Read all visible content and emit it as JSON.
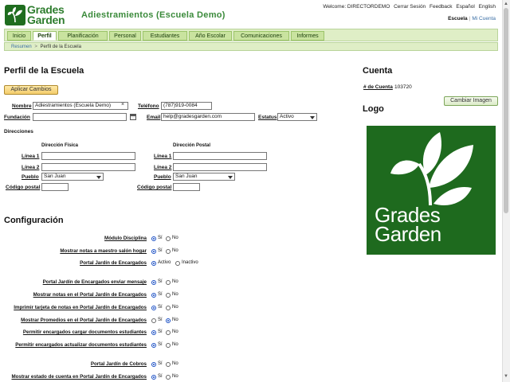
{
  "header": {
    "logo_text_1": "Grades",
    "logo_text_2": "Garden",
    "school_name": "Adiestramientos (Escuela Demo)",
    "welcome": "Welcome: DIRECTORDEMO",
    "links": [
      "Cerrar Sesión",
      "Feedback",
      "Español",
      "English"
    ],
    "school_link": "Escuela",
    "account_link": "Mi Cuenta"
  },
  "tabs": [
    {
      "label": "Inicio",
      "active": false
    },
    {
      "label": "Perfil",
      "active": true
    },
    {
      "label": "Planificación",
      "active": false
    },
    {
      "label": "Personal",
      "active": false
    },
    {
      "label": "Estudiantes",
      "active": false
    },
    {
      "label": "Año Escolar",
      "active": false
    },
    {
      "label": "Comunicaciones",
      "active": false
    },
    {
      "label": "Informes",
      "active": false
    }
  ],
  "breadcrumb": {
    "parent": "Resumen",
    "separator": ">",
    "current": "Perfil de la Escuela"
  },
  "profile": {
    "title": "Perfil de la Escuela",
    "apply_button": "Aplicar Cambios",
    "nombre_label": "Nombre",
    "nombre_value": "Adiestramientos (Escuela Demo)",
    "telefono_label": "Teléfono",
    "telefono_value": "(787)919-0084",
    "fundacion_label": "Fundación",
    "fundacion_value": "",
    "email_label": "Email",
    "email_value": "help@gradesgarden.com",
    "estatus_label": "Estatus",
    "estatus_value": "Activo"
  },
  "addresses": {
    "title": "Direcciones",
    "fisica_title": "Dirección Física",
    "postal_title": "Dirección Postal",
    "linea1": "Línea 1",
    "linea2": "Línea 2",
    "pueblo": "Pueblo",
    "codigo": "Código postal",
    "fisica_pueblo": "San Juan",
    "postal_pueblo": "San Juan"
  },
  "config": {
    "title": "Configuración",
    "rows": [
      {
        "label": "Módulo Disciplina",
        "opt1": "Sí",
        "opt2": "No",
        "selected": 1
      },
      {
        "label": "Mostrar notas a maestro salón hogar",
        "opt1": "Sí",
        "opt2": "No",
        "selected": 1
      },
      {
        "label": "Portal Jardín de Encargados",
        "opt1": "Activo",
        "opt2": "Inactivo",
        "selected": 1
      },
      {
        "label": "Portal Jardín de Encargados enviar mensaje",
        "opt1": "Sí",
        "opt2": "No",
        "selected": 1
      },
      {
        "label": "Mostrar notas en el Portal Jardín de Encargados",
        "opt1": "Sí",
        "opt2": "No",
        "selected": 1
      },
      {
        "label": "Imprimir tarjeta de notas en Portal Jardín de Encargados",
        "opt1": "Sí",
        "opt2": "No",
        "selected": 1
      },
      {
        "label": "Mostrar Promedios en el Portal Jardín de Encargados",
        "opt1": "Sí",
        "opt2": "No",
        "selected": 2
      },
      {
        "label": "Permitir encargados cargar documentos estudiantes",
        "opt1": "Sí",
        "opt2": "No",
        "selected": 1
      },
      {
        "label": "Permitir encargados actualizar documentos estudiantes",
        "opt1": "Sí",
        "opt2": "No",
        "selected": 1
      },
      {
        "label": "Portal Jardín de Cobros",
        "opt1": "Sí",
        "opt2": "No",
        "selected": 1
      },
      {
        "label": "Mostrar estado de cuenta en Portal Jardín de Encargados",
        "opt1": "Sí",
        "opt2": "No",
        "selected": 1
      }
    ]
  },
  "account": {
    "title": "Cuenta",
    "num_label": "# de Cuenta",
    "num_value": "103720",
    "logo_title": "Logo",
    "change_image_button": "Cambiar Imagen",
    "logo_text_1": "Grades",
    "logo_text_2": "Garden"
  },
  "colors": {
    "brand_green": "#2e7d2e",
    "logo_bg": "#1e6a1e",
    "tab_bg": "#c9e39f",
    "button_gold": "#f3cc6a"
  }
}
